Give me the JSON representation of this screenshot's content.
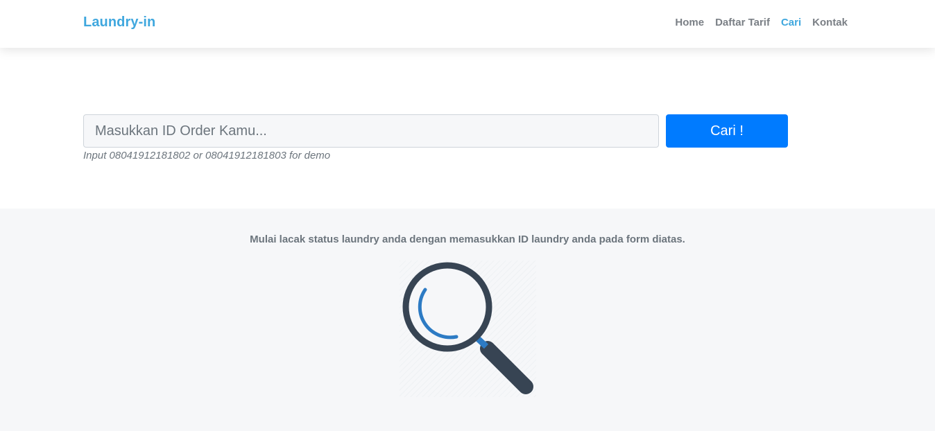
{
  "navbar": {
    "brand": "Laundry-in",
    "links": [
      {
        "label": "Home",
        "active": false
      },
      {
        "label": "Daftar Tarif",
        "active": false
      },
      {
        "label": "Cari",
        "active": true
      },
      {
        "label": "Kontak",
        "active": false
      }
    ]
  },
  "search": {
    "placeholder": "Masukkan ID Order Kamu...",
    "value": "",
    "button_label": "Cari !",
    "hint": "Input 08041912181802 or 08041912181803 for demo"
  },
  "result": {
    "message": "Mulai lacak status laundry anda dengan memasukkan ID laundry anda pada form diatas.",
    "illustration_icon": "magnifying-glass-icon"
  },
  "colors": {
    "brand": "#3fa7de",
    "primary_button": "#007bff",
    "illustration_dark": "#374453",
    "illustration_accent": "#2d7bc4",
    "section_background": "#f6f7f9"
  }
}
